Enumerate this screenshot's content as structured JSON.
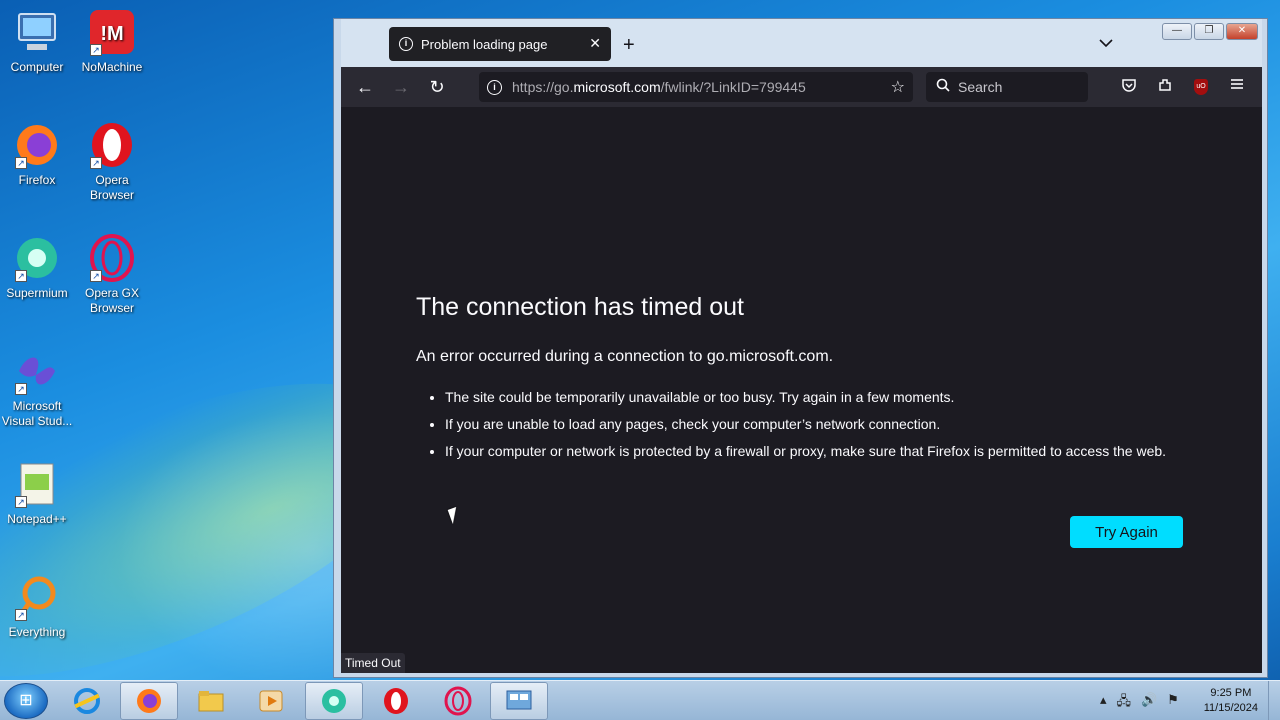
{
  "desktop": {
    "icons": [
      {
        "label": "Computer"
      },
      {
        "label": "NoMachine"
      },
      {
        "label": "Firefox"
      },
      {
        "label": "Opera Browser"
      },
      {
        "label": "Supermium"
      },
      {
        "label": "Opera GX Browser"
      },
      {
        "label": "Microsoft Visual Stud..."
      },
      {
        "label": "Notepad++"
      },
      {
        "label": "Everything"
      }
    ]
  },
  "browser": {
    "tab": {
      "title": "Problem loading page"
    },
    "url": {
      "prefix": "https://go.",
      "host": "microsoft.com",
      "path": "/fwlink/?LinkID=799445"
    },
    "search_placeholder": "Search",
    "error": {
      "title": "The connection has timed out",
      "description": "An error occurred during a connection to go.microsoft.com.",
      "bullets": [
        "The site could be temporarily unavailable or too busy. Try again in a few moments.",
        "If you are unable to load any pages, check your computer’s network connection.",
        "If your computer or network is protected by a firewall or proxy, make sure that Firefox is permitted to access the web."
      ],
      "button": "Try Again"
    },
    "status_text": "Timed Out",
    "ublock_badge": "uO"
  },
  "taskbar": {
    "clock_time": "9:25 PM",
    "clock_date": "11/15/2024"
  },
  "colors": {
    "page_bg": "#1c1b22",
    "accent_button": "#00ddff",
    "toolbar": "#2b2a33"
  }
}
